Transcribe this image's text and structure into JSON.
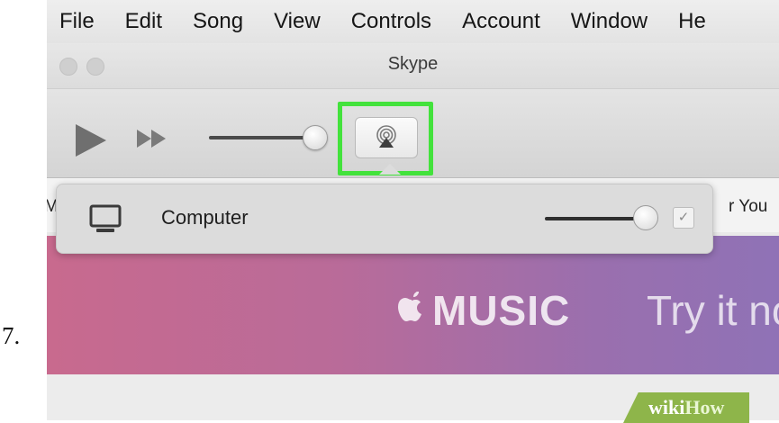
{
  "step": {
    "number": "7."
  },
  "menubar": {
    "items": [
      "File",
      "Edit",
      "Song",
      "View",
      "Controls",
      "Account",
      "Window",
      "He"
    ]
  },
  "window": {
    "title": "Skype"
  },
  "toolbar": {
    "icons": {
      "play": "play-icon",
      "fast_forward": "fast-forward-icon",
      "airplay": "airplay-icon"
    },
    "volume_level": 0.9,
    "highlight_color": "#43e23c"
  },
  "tabs": {
    "left_fragment": "M",
    "right_fragment": "r You"
  },
  "popover": {
    "device_label": "Computer",
    "device_icon": "computer-icon",
    "volume_level": 0.9,
    "checkbox_mark": "✓"
  },
  "banner": {
    "brand": "MUSIC",
    "cta": "Try it no",
    "gradient": [
      "#c86a8e",
      "#8f72b6"
    ]
  },
  "watermark": {
    "wiki": "wiki",
    "how": "How"
  }
}
